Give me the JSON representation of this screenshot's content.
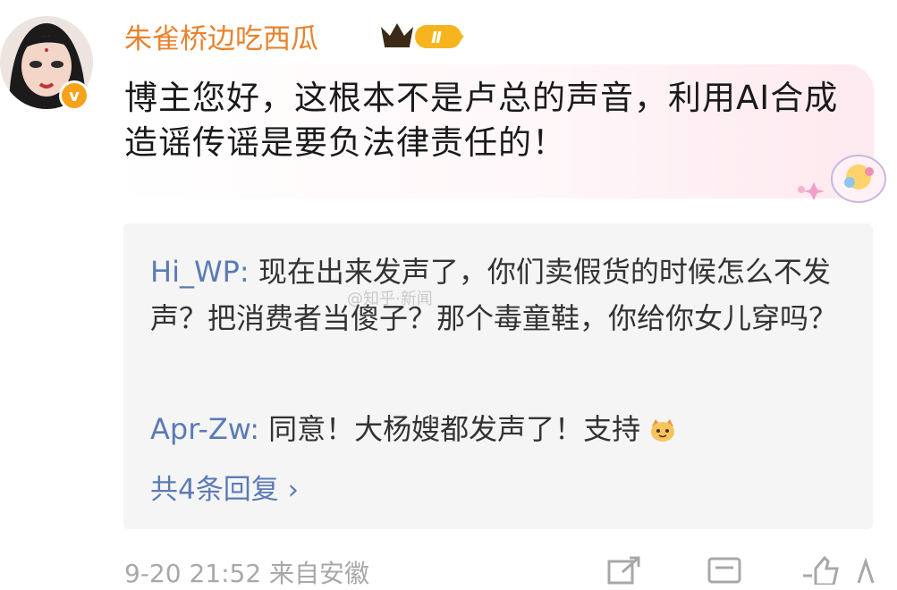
{
  "comment": {
    "username": "朱雀桥边吃西瓜",
    "level_badge": "Ⅱ",
    "text": "博主您好，这根本不是卢总的声音，利用AI合成造谣传谣是要负法律责任的！",
    "verified_mark": "v"
  },
  "replies": [
    {
      "name": "Hi_WP:",
      "text": "现在出来发声了，你们卖假货的时候怎么不发声？把消费者当傻子？那个毒童鞋，你给你女儿穿吗？"
    },
    {
      "name": "Apr-Zw:",
      "text": "同意！大杨嫂都发声了！支持"
    }
  ],
  "watermark": "@知乎·新闻",
  "more_replies": "共4条回复 ›",
  "footer": {
    "meta": "9-20 21:52  来自安徽"
  },
  "icons": {
    "crown": "crown-icon",
    "sticker": "sticker-icon",
    "reply_emoji": "cat-face-icon",
    "share": "share-icon",
    "comment": "comment-icon",
    "like": "like-icon"
  },
  "colors": {
    "username": "#e8832d",
    "reply_name": "#5b7bb5",
    "meta": "#a8a8a8",
    "reply_bg": "#f5f5f5"
  }
}
